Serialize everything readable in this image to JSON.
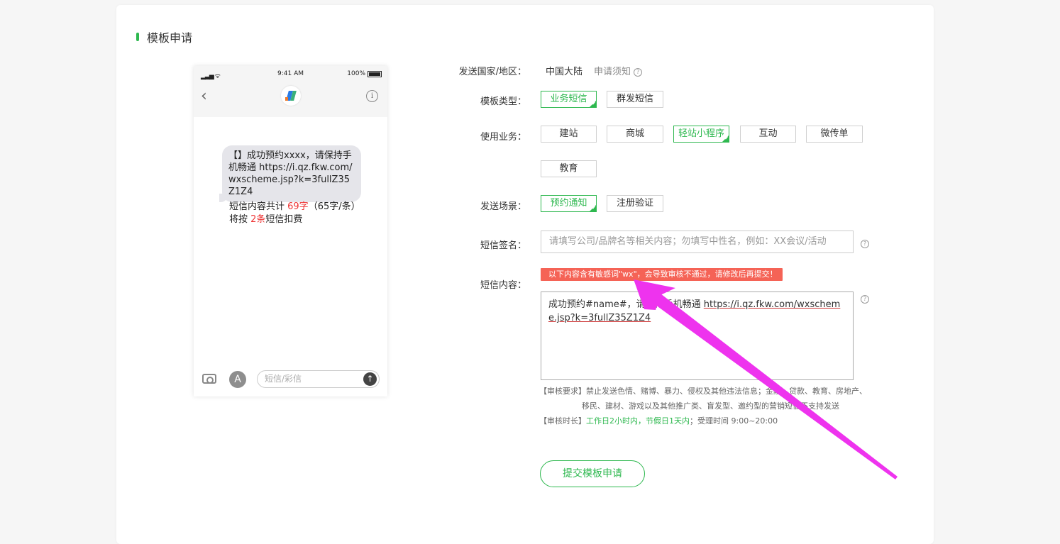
{
  "section_title": "模板申请",
  "phone": {
    "status_time": "9:41 AM",
    "status_battery": "100%",
    "message_bubble": "【】成功预约xxxx，请保持手机畅通 https://i.qz.fkw.com/wxscheme.jsp?k=3fullZ35Z1Z4",
    "count_prefix": "短信内容共计 ",
    "count_chars": "69字",
    "count_mid": "（65字/条）将按 ",
    "count_msgs": "2条",
    "count_suffix": "短信扣费",
    "input_placeholder": "短信/彩信"
  },
  "form": {
    "country_label": "发送国家/地区：",
    "country_value": "中国大陆",
    "notice_link": "申请须知",
    "type_label": "模板类型：",
    "type_options": [
      "业务短信",
      "群发短信"
    ],
    "type_selected": "业务短信",
    "business_label": "使用业务：",
    "business_options": [
      "建站",
      "商城",
      "轻站小程序",
      "互动",
      "微传单",
      "教育"
    ],
    "business_selected": "轻站小程序",
    "scene_label": "发送场景：",
    "scene_options": [
      "预约通知",
      "注册验证"
    ],
    "scene_selected": "预约通知",
    "signature_label": "短信签名：",
    "signature_placeholder": "请填写公司/品牌名等相关内容；勿填写中性名，例如：XX会议/活动",
    "content_label": "短信内容：",
    "warning": "以下内容含有敏感词\"wx\"，会导致审核不通过，请修改后再提交！",
    "content_text_a": "成功预约#name#，请保持手机畅通 ",
    "content_text_b": "https://i.qz.fkw.com/wxscheme.jsp?k=3fullZ35Z1Z4",
    "review_req_tag": "【审核要求】",
    "review_req_text_1": "禁止发送色情、赌博、暴力、侵权及其他违法信息；金融、贷款、教育、房地产、",
    "review_req_text_2": "移民、建材、游戏以及其他推广类、盲发型、邀约型的营销短信不支持发送",
    "review_time_tag": "【审核时长】",
    "review_time_green": "工作日2小时内，节假日1天内",
    "review_time_rest": "；受理时间 9:00~20:00",
    "submit": "提交模板申请"
  },
  "colors": {
    "accent": "#2eb84f",
    "warning_bg": "#f56356",
    "annotation_arrow": "#ee33ee"
  }
}
